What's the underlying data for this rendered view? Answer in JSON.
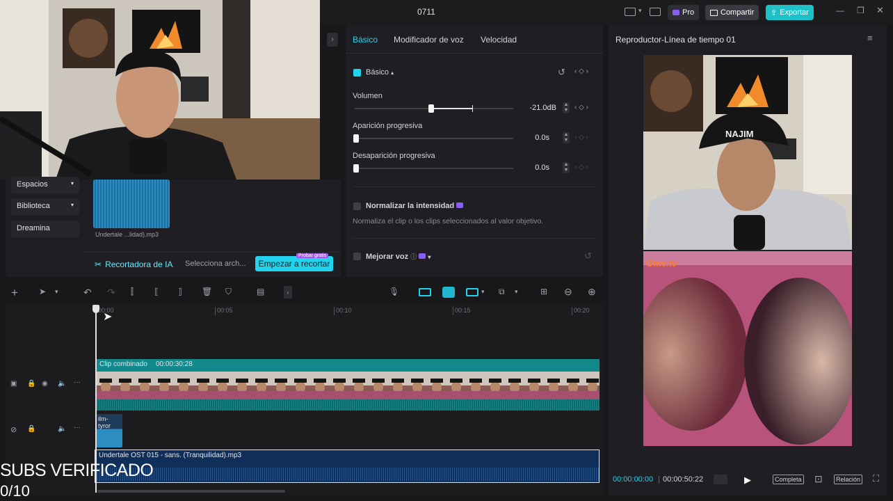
{
  "app": {
    "title": "0711"
  },
  "topbar": {
    "pro_label": "Pro",
    "share_label": "Compartir",
    "export_label": "Exportar"
  },
  "sidebar": {
    "items": [
      {
        "label": "Espacios"
      },
      {
        "label": "Biblioteca"
      },
      {
        "label": "Dreamina"
      }
    ]
  },
  "media": {
    "clip_label": "Undertale ...lidad).mp3",
    "ai_title": "Recortadora de IA",
    "ai_select": "Selecciona arch...",
    "ai_start_label": "Empezar a recortar",
    "ai_free_badge": "Probar gratis"
  },
  "props": {
    "tabs": [
      "Básico",
      "Modificador de voz",
      "Velocidad"
    ],
    "section_title": "Básico",
    "volume": {
      "label": "Volumen",
      "value": "-21.0dB"
    },
    "fade_in": {
      "label": "Aparición progresiva",
      "value": "0.0s"
    },
    "fade_out": {
      "label": "Desaparición progresiva",
      "value": "0.0s"
    },
    "normalize": {
      "label": "Normalizar la intensidad",
      "desc": "Normaliza el clip o los clips seleccionados al valor objetivo."
    },
    "enhance": {
      "label": "Mejorar voz"
    }
  },
  "player": {
    "title": "Reproductor-Línea de tiempo 01",
    "time_current": "00:00:00:00",
    "time_total": "00:00:50:22",
    "full_label": "Completa",
    "ratio_label": "Relación",
    "overlay_text": "Ome.tv"
  },
  "timeline": {
    "ruler": [
      "00:00",
      "00:05",
      "00:10",
      "00:15",
      "00:20"
    ],
    "main_clip_name": "Clip combinado",
    "main_clip_duration": "00:00:30:28",
    "ilm_clip": "ilm-tyror",
    "music_clip": "Undertale OST 015 - sans. (Tranquilidad).mp3"
  },
  "overlay": {
    "subs_title": "SUBS VERIFICADO",
    "subs_count": "0/10"
  },
  "colors": {
    "accent": "#22d3ee",
    "track": "#12898a",
    "audio": "#0f2f5a"
  }
}
